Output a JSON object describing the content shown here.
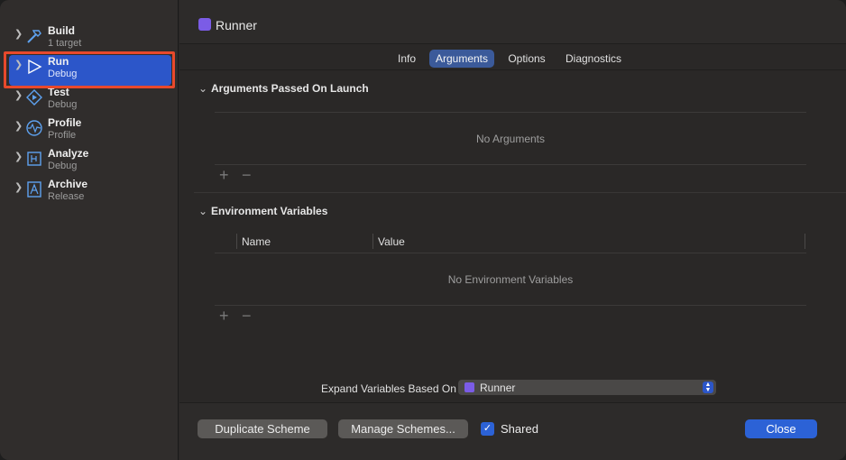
{
  "project": {
    "title": "Runner",
    "icon": "app-icon"
  },
  "sidebar": {
    "items": [
      {
        "title": "Build",
        "sub": "1 target",
        "icon": "hammer-icon"
      },
      {
        "title": "Run",
        "sub": "Debug",
        "icon": "play-icon",
        "selected": true
      },
      {
        "title": "Test",
        "sub": "Debug",
        "icon": "test-diamond-icon"
      },
      {
        "title": "Profile",
        "sub": "Profile",
        "icon": "waveform-icon"
      },
      {
        "title": "Analyze",
        "sub": "Debug",
        "icon": "analyze-icon"
      },
      {
        "title": "Archive",
        "sub": "Release",
        "icon": "archive-icon"
      }
    ]
  },
  "tabs": [
    "Info",
    "Arguments",
    "Options",
    "Diagnostics"
  ],
  "active_tab": "Arguments",
  "arguments": {
    "heading": "Arguments Passed On Launch",
    "empty": "No Arguments",
    "add": "+",
    "remove": "−"
  },
  "environment": {
    "heading": "Environment Variables",
    "columns": [
      "Name",
      "Value"
    ],
    "empty": "No Environment Variables",
    "add": "+",
    "remove": "−"
  },
  "expand": {
    "label": "Expand Variables Based On",
    "value": "Runner"
  },
  "footer": {
    "duplicate": "Duplicate Scheme",
    "manage": "Manage Schemes...",
    "shared_label": "Shared",
    "shared_checked": true,
    "close": "Close"
  },
  "colors": {
    "accent": "#2c56c9",
    "highlight": "#e8492c",
    "app_icon": "#7b5ce6"
  }
}
